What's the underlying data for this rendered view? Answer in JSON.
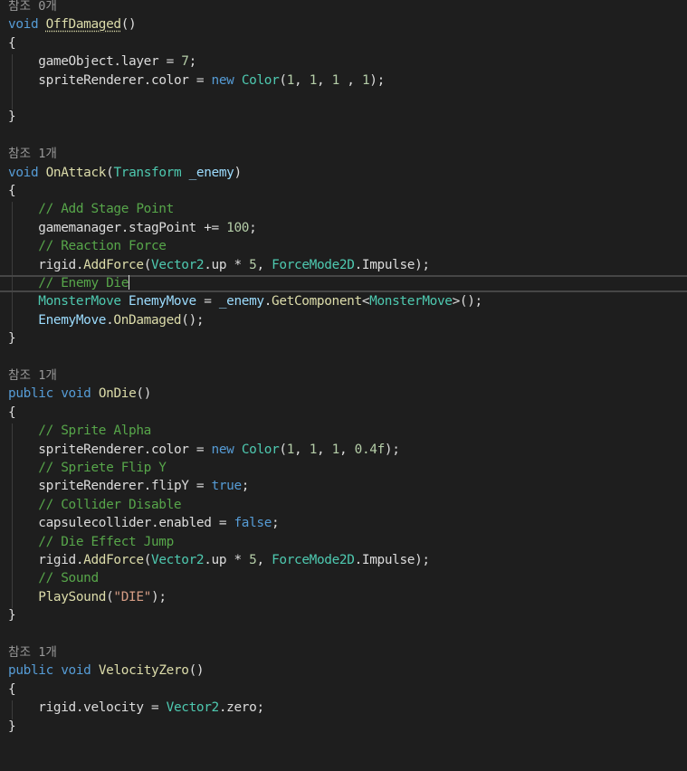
{
  "editor": {
    "colors": {
      "background": "#1e1e1e",
      "text": "#dcdcdc",
      "keyword": "#569cd6",
      "type": "#4ec9b0",
      "function": "#dcdcaa",
      "comment": "#57a64a",
      "number": "#b5cea8",
      "string": "#d69d85",
      "codelens": "#999999"
    },
    "lines": [
      {
        "kind": "codelens",
        "text": "참조 0개"
      },
      {
        "kind": "code",
        "tokens": [
          {
            "t": "kw",
            "v": "void"
          },
          {
            "t": "punc",
            "v": " "
          },
          {
            "t": "fn-ref",
            "v": "OffDamaged"
          },
          {
            "t": "punc",
            "v": "()"
          }
        ]
      },
      {
        "kind": "code",
        "tokens": [
          {
            "t": "punc",
            "v": "{"
          }
        ]
      },
      {
        "kind": "code",
        "tokens": [
          {
            "t": "punc",
            "v": "    "
          },
          {
            "t": "id",
            "v": "gameObject"
          },
          {
            "t": "punc",
            "v": "."
          },
          {
            "t": "id",
            "v": "layer"
          },
          {
            "t": "punc",
            "v": " = "
          },
          {
            "t": "num",
            "v": "7"
          },
          {
            "t": "punc",
            "v": ";"
          }
        ]
      },
      {
        "kind": "code",
        "tokens": [
          {
            "t": "punc",
            "v": "    "
          },
          {
            "t": "id",
            "v": "spriteRenderer"
          },
          {
            "t": "punc",
            "v": "."
          },
          {
            "t": "id",
            "v": "color"
          },
          {
            "t": "punc",
            "v": " = "
          },
          {
            "t": "kw",
            "v": "new"
          },
          {
            "t": "punc",
            "v": " "
          },
          {
            "t": "type",
            "v": "Color"
          },
          {
            "t": "punc",
            "v": "("
          },
          {
            "t": "num",
            "v": "1"
          },
          {
            "t": "punc",
            "v": ", "
          },
          {
            "t": "num",
            "v": "1"
          },
          {
            "t": "punc",
            "v": ", "
          },
          {
            "t": "num",
            "v": "1"
          },
          {
            "t": "punc",
            "v": " , "
          },
          {
            "t": "num",
            "v": "1"
          },
          {
            "t": "punc",
            "v": ");"
          }
        ]
      },
      {
        "kind": "code",
        "tokens": []
      },
      {
        "kind": "code",
        "tokens": [
          {
            "t": "punc",
            "v": "}"
          }
        ]
      },
      {
        "kind": "code",
        "tokens": []
      },
      {
        "kind": "codelens",
        "text": "참조 1개"
      },
      {
        "kind": "code",
        "tokens": [
          {
            "t": "kw",
            "v": "void"
          },
          {
            "t": "punc",
            "v": " "
          },
          {
            "t": "fn",
            "v": "OnAttack"
          },
          {
            "t": "punc",
            "v": "("
          },
          {
            "t": "type",
            "v": "Transform"
          },
          {
            "t": "punc",
            "v": " "
          },
          {
            "t": "param",
            "v": "_enemy"
          },
          {
            "t": "punc",
            "v": ")"
          }
        ]
      },
      {
        "kind": "code",
        "tokens": [
          {
            "t": "punc",
            "v": "{"
          }
        ]
      },
      {
        "kind": "code",
        "tokens": [
          {
            "t": "punc",
            "v": "    "
          },
          {
            "t": "cm",
            "v": "// Add Stage Point"
          }
        ]
      },
      {
        "kind": "code",
        "tokens": [
          {
            "t": "punc",
            "v": "    "
          },
          {
            "t": "id",
            "v": "gamemanager"
          },
          {
            "t": "punc",
            "v": "."
          },
          {
            "t": "id",
            "v": "stagPoint"
          },
          {
            "t": "punc",
            "v": " += "
          },
          {
            "t": "num",
            "v": "100"
          },
          {
            "t": "punc",
            "v": ";"
          }
        ]
      },
      {
        "kind": "code",
        "tokens": [
          {
            "t": "punc",
            "v": "    "
          },
          {
            "t": "cm",
            "v": "// Reaction Force"
          }
        ]
      },
      {
        "kind": "code",
        "tokens": [
          {
            "t": "punc",
            "v": "    "
          },
          {
            "t": "id",
            "v": "rigid"
          },
          {
            "t": "punc",
            "v": "."
          },
          {
            "t": "fn",
            "v": "AddForce"
          },
          {
            "t": "punc",
            "v": "("
          },
          {
            "t": "type",
            "v": "Vector2"
          },
          {
            "t": "punc",
            "v": "."
          },
          {
            "t": "id",
            "v": "up"
          },
          {
            "t": "punc",
            "v": " * "
          },
          {
            "t": "num",
            "v": "5"
          },
          {
            "t": "punc",
            "v": ", "
          },
          {
            "t": "type",
            "v": "ForceMode2D"
          },
          {
            "t": "punc",
            "v": "."
          },
          {
            "t": "id",
            "v": "Impulse"
          },
          {
            "t": "punc",
            "v": ");"
          }
        ]
      },
      {
        "kind": "code",
        "current": true,
        "tokens": [
          {
            "t": "punc",
            "v": "    "
          },
          {
            "t": "cm",
            "v": "// Enemy Die"
          }
        ]
      },
      {
        "kind": "code",
        "tokens": [
          {
            "t": "punc",
            "v": "    "
          },
          {
            "t": "type",
            "v": "MonsterMove"
          },
          {
            "t": "punc",
            "v": " "
          },
          {
            "t": "param",
            "v": "EnemyMove"
          },
          {
            "t": "punc",
            "v": " = "
          },
          {
            "t": "param",
            "v": "_enemy"
          },
          {
            "t": "punc",
            "v": "."
          },
          {
            "t": "fn",
            "v": "GetComponent"
          },
          {
            "t": "punc",
            "v": "<"
          },
          {
            "t": "type",
            "v": "MonsterMove"
          },
          {
            "t": "punc",
            "v": ">();"
          }
        ]
      },
      {
        "kind": "code",
        "tokens": [
          {
            "t": "punc",
            "v": "    "
          },
          {
            "t": "param",
            "v": "EnemyMove"
          },
          {
            "t": "punc",
            "v": "."
          },
          {
            "t": "fn",
            "v": "OnDamaged"
          },
          {
            "t": "punc",
            "v": "();"
          }
        ]
      },
      {
        "kind": "code",
        "tokens": [
          {
            "t": "punc",
            "v": "}"
          }
        ]
      },
      {
        "kind": "code",
        "tokens": []
      },
      {
        "kind": "codelens",
        "text": "참조 1개"
      },
      {
        "kind": "code",
        "tokens": [
          {
            "t": "kw",
            "v": "public"
          },
          {
            "t": "punc",
            "v": " "
          },
          {
            "t": "kw",
            "v": "void"
          },
          {
            "t": "punc",
            "v": " "
          },
          {
            "t": "fn",
            "v": "OnDie"
          },
          {
            "t": "punc",
            "v": "()"
          }
        ]
      },
      {
        "kind": "code",
        "tokens": [
          {
            "t": "punc",
            "v": "{"
          }
        ]
      },
      {
        "kind": "code",
        "tokens": [
          {
            "t": "punc",
            "v": "    "
          },
          {
            "t": "cm",
            "v": "// Sprite Alpha"
          }
        ]
      },
      {
        "kind": "code",
        "tokens": [
          {
            "t": "punc",
            "v": "    "
          },
          {
            "t": "id",
            "v": "spriteRenderer"
          },
          {
            "t": "punc",
            "v": "."
          },
          {
            "t": "id",
            "v": "color"
          },
          {
            "t": "punc",
            "v": " = "
          },
          {
            "t": "kw",
            "v": "new"
          },
          {
            "t": "punc",
            "v": " "
          },
          {
            "t": "type",
            "v": "Color"
          },
          {
            "t": "punc",
            "v": "("
          },
          {
            "t": "num",
            "v": "1"
          },
          {
            "t": "punc",
            "v": ", "
          },
          {
            "t": "num",
            "v": "1"
          },
          {
            "t": "punc",
            "v": ", "
          },
          {
            "t": "num",
            "v": "1"
          },
          {
            "t": "punc",
            "v": ", "
          },
          {
            "t": "num",
            "v": "0.4f"
          },
          {
            "t": "punc",
            "v": ");"
          }
        ]
      },
      {
        "kind": "code",
        "tokens": [
          {
            "t": "punc",
            "v": "    "
          },
          {
            "t": "cm",
            "v": "// Spriete Flip Y"
          }
        ]
      },
      {
        "kind": "code",
        "tokens": [
          {
            "t": "punc",
            "v": "    "
          },
          {
            "t": "id",
            "v": "spriteRenderer"
          },
          {
            "t": "punc",
            "v": "."
          },
          {
            "t": "id",
            "v": "flipY"
          },
          {
            "t": "punc",
            "v": " = "
          },
          {
            "t": "kw",
            "v": "true"
          },
          {
            "t": "punc",
            "v": ";"
          }
        ]
      },
      {
        "kind": "code",
        "tokens": [
          {
            "t": "punc",
            "v": "    "
          },
          {
            "t": "cm",
            "v": "// Collider Disable"
          }
        ]
      },
      {
        "kind": "code",
        "tokens": [
          {
            "t": "punc",
            "v": "    "
          },
          {
            "t": "id",
            "v": "capsulecollider"
          },
          {
            "t": "punc",
            "v": "."
          },
          {
            "t": "id",
            "v": "enabled"
          },
          {
            "t": "punc",
            "v": " = "
          },
          {
            "t": "kw",
            "v": "false"
          },
          {
            "t": "punc",
            "v": ";"
          }
        ]
      },
      {
        "kind": "code",
        "tokens": [
          {
            "t": "punc",
            "v": "    "
          },
          {
            "t": "cm",
            "v": "// Die Effect Jump"
          }
        ]
      },
      {
        "kind": "code",
        "tokens": [
          {
            "t": "punc",
            "v": "    "
          },
          {
            "t": "id",
            "v": "rigid"
          },
          {
            "t": "punc",
            "v": "."
          },
          {
            "t": "fn",
            "v": "AddForce"
          },
          {
            "t": "punc",
            "v": "("
          },
          {
            "t": "type",
            "v": "Vector2"
          },
          {
            "t": "punc",
            "v": "."
          },
          {
            "t": "id",
            "v": "up"
          },
          {
            "t": "punc",
            "v": " * "
          },
          {
            "t": "num",
            "v": "5"
          },
          {
            "t": "punc",
            "v": ", "
          },
          {
            "t": "type",
            "v": "ForceMode2D"
          },
          {
            "t": "punc",
            "v": "."
          },
          {
            "t": "id",
            "v": "Impulse"
          },
          {
            "t": "punc",
            "v": ");"
          }
        ]
      },
      {
        "kind": "code",
        "tokens": [
          {
            "t": "punc",
            "v": "    "
          },
          {
            "t": "cm",
            "v": "// Sound"
          }
        ]
      },
      {
        "kind": "code",
        "tokens": [
          {
            "t": "punc",
            "v": "    "
          },
          {
            "t": "fn",
            "v": "PlaySound"
          },
          {
            "t": "punc",
            "v": "("
          },
          {
            "t": "str",
            "v": "\"DIE\""
          },
          {
            "t": "punc",
            "v": ");"
          }
        ]
      },
      {
        "kind": "code",
        "tokens": [
          {
            "t": "punc",
            "v": "}"
          }
        ]
      },
      {
        "kind": "code",
        "tokens": []
      },
      {
        "kind": "codelens",
        "text": "참조 1개"
      },
      {
        "kind": "code",
        "tokens": [
          {
            "t": "kw",
            "v": "public"
          },
          {
            "t": "punc",
            "v": " "
          },
          {
            "t": "kw",
            "v": "void"
          },
          {
            "t": "punc",
            "v": " "
          },
          {
            "t": "fn",
            "v": "VelocityZero"
          },
          {
            "t": "punc",
            "v": "()"
          }
        ]
      },
      {
        "kind": "code",
        "tokens": [
          {
            "t": "punc",
            "v": "{"
          }
        ]
      },
      {
        "kind": "code",
        "tokens": [
          {
            "t": "punc",
            "v": "    "
          },
          {
            "t": "id",
            "v": "rigid"
          },
          {
            "t": "punc",
            "v": "."
          },
          {
            "t": "id",
            "v": "velocity"
          },
          {
            "t": "punc",
            "v": " = "
          },
          {
            "t": "type",
            "v": "Vector2"
          },
          {
            "t": "punc",
            "v": "."
          },
          {
            "t": "id",
            "v": "zero"
          },
          {
            "t": "punc",
            "v": ";"
          }
        ]
      },
      {
        "kind": "code",
        "tokens": [
          {
            "t": "punc",
            "v": "}"
          }
        ]
      }
    ]
  }
}
